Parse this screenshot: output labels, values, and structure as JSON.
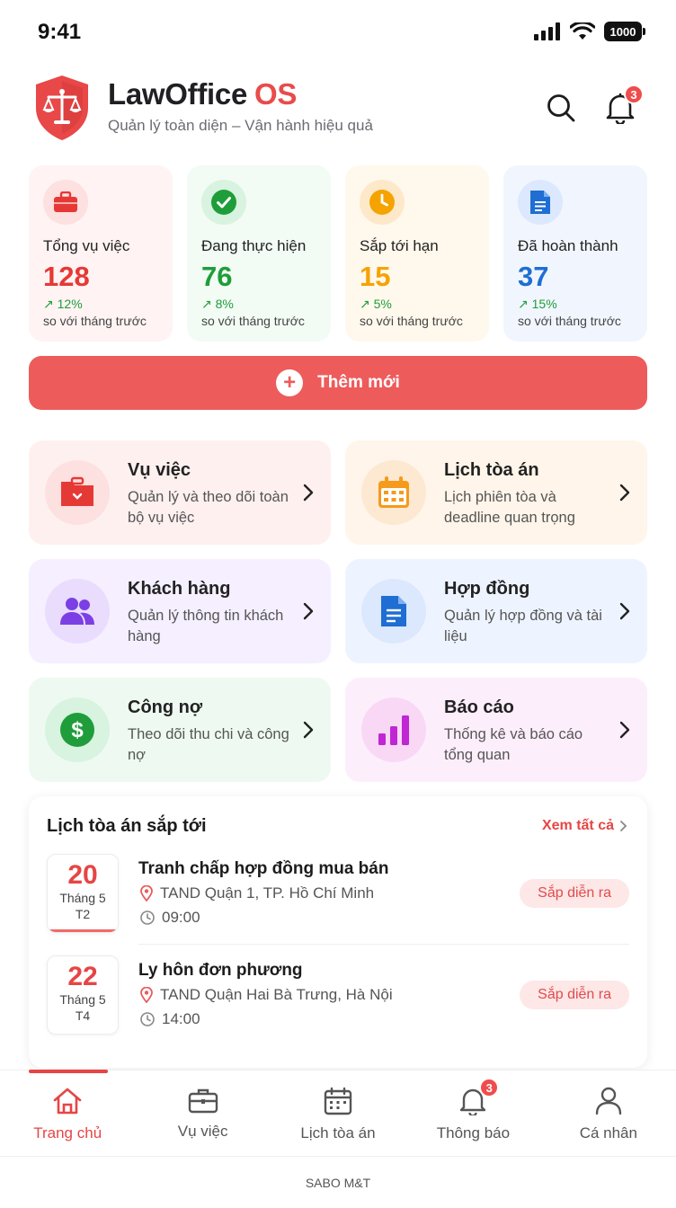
{
  "status_bar": {
    "time": "9:41",
    "battery": "1000"
  },
  "header": {
    "brand_name": "LawOffice",
    "brand_suffix": "OS",
    "tagline": "Quản lý toàn diện – Vận hành hiệu quả",
    "notification_count": "3"
  },
  "stats": [
    {
      "label": "Tổng vụ việc",
      "value": "128",
      "trend": "↗ 12%",
      "sub": "so với tháng trước",
      "color": "#e53935",
      "bg": "#fff3f3",
      "icon": "briefcase-icon"
    },
    {
      "label": "Đang thực hiện",
      "value": "76",
      "trend": "↗ 8%",
      "sub": "so với tháng trước",
      "color": "#1f9d3a",
      "bg": "#f2fbf4",
      "icon": "check-circle-icon"
    },
    {
      "label": "Sắp tới hạn",
      "value": "15",
      "trend": "↗ 5%",
      "sub": "so với tháng trước",
      "color": "#f5a300",
      "bg": "#fff8ec",
      "icon": "clock-icon"
    },
    {
      "label": "Đã hoàn thành",
      "value": "37",
      "trend": "↗ 15%",
      "sub": "so với tháng trước",
      "color": "#1f6ed4",
      "bg": "#f1f6fe",
      "icon": "document-icon"
    }
  ],
  "add_button": {
    "label": "Thêm mới"
  },
  "modules": [
    {
      "title": "Vụ việc",
      "desc": "Quản lý và theo dõi toàn bộ vụ việc",
      "bg": "#fff0f0",
      "icon_bg": "#fde0e0",
      "color": "#e53935",
      "icon": "folder-icon"
    },
    {
      "title": "Lịch tòa án",
      "desc": "Lịch phiên tòa và deadline quan trọng",
      "bg": "#fff5ea",
      "icon_bg": "#fde8d2",
      "color": "#f59a1b",
      "icon": "calendar-icon"
    },
    {
      "title": "Khách hàng",
      "desc": "Quản lý thông tin khách hàng",
      "bg": "#f5efff",
      "icon_bg": "#e9dcfd",
      "color": "#7b3fe4",
      "icon": "users-icon"
    },
    {
      "title": "Hợp đồng",
      "desc": "Quản lý hợp đồng và tài liệu",
      "bg": "#eef4ff",
      "icon_bg": "#dce8fd",
      "color": "#1f6ed4",
      "icon": "contract-icon"
    },
    {
      "title": "Công nợ",
      "desc": "Theo dõi thu chi và công nợ",
      "bg": "#eefaf1",
      "icon_bg": "#d8f3df",
      "color": "#1f9d3a",
      "icon": "dollar-icon"
    },
    {
      "title": "Báo cáo",
      "desc": "Thống kê và báo cáo tổng quan",
      "bg": "#fdeefc",
      "icon_bg": "#f9d8f6",
      "color": "#c026d3",
      "icon": "bar-chart-icon"
    }
  ],
  "court_schedule": {
    "title": "Lịch tòa án sắp tới",
    "see_all": "Xem tất cả",
    "events": [
      {
        "day": "20",
        "month": "Tháng 5",
        "weekday": "T2",
        "title": "Tranh chấp hợp đồng mua bán",
        "location": "TAND Quận 1, TP. Hồ Chí Minh",
        "time": "09:00",
        "status": "Sắp diễn ra"
      },
      {
        "day": "22",
        "month": "Tháng 5",
        "weekday": "T4",
        "title": "Ly hôn đơn phương",
        "location": "TAND Quận Hai Bà Trưng, Hà Nội",
        "time": "14:00",
        "status": "Sắp diễn ra"
      }
    ]
  },
  "tabs": [
    {
      "label": "Trang chủ",
      "icon": "home-icon",
      "active": true
    },
    {
      "label": "Vụ việc",
      "icon": "briefcase-icon",
      "active": false
    },
    {
      "label": "Lịch tòa án",
      "icon": "calendar-icon",
      "active": false
    },
    {
      "label": "Thông báo",
      "icon": "bell-icon",
      "active": false,
      "badge": "3"
    },
    {
      "label": "Cá nhân",
      "icon": "user-icon",
      "active": false
    }
  ],
  "footer": {
    "text": "SABO M&T"
  },
  "colors": {
    "accent": "#e64545",
    "button": "#ee5b5b"
  }
}
